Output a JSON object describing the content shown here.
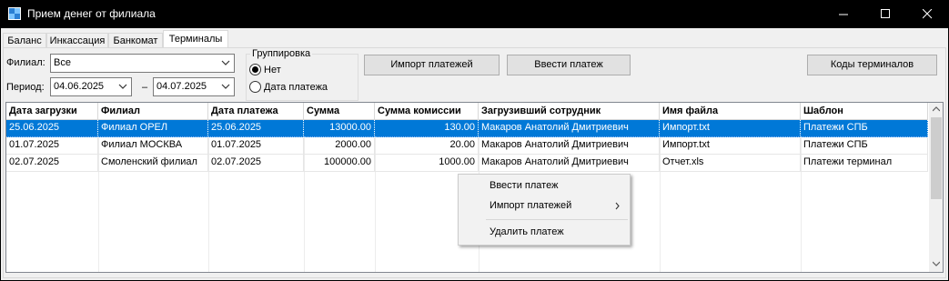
{
  "window": {
    "title": "Прием денег от филиала",
    "icon": "app-grid-icon"
  },
  "tabs": [
    {
      "label": "Баланс",
      "active": false
    },
    {
      "label": "Инкассация",
      "active": false
    },
    {
      "label": "Банкомат",
      "active": false
    },
    {
      "label": "Терминалы",
      "active": true
    }
  ],
  "filters": {
    "branch_label": "Филиал:",
    "branch_value": "Все",
    "period_label": "Период:",
    "date_from": "04.06.2025",
    "date_separator": "–",
    "date_to": "04.07.2025"
  },
  "grouping": {
    "title": "Группировка",
    "options": [
      {
        "label": "Нет",
        "checked": true
      },
      {
        "label": "Дата платежа",
        "checked": false
      }
    ]
  },
  "buttons": {
    "import": "Импорт платежей",
    "enter": "Ввести платеж",
    "terminal_codes": "Коды терминалов"
  },
  "table": {
    "columns": [
      "Дата загрузки",
      "Филиал",
      "Дата платежа",
      "Сумма",
      "Сумма комиссии",
      "Загрузивший сотрудник",
      "Имя файла",
      "Шаблон"
    ],
    "rows": [
      [
        "25.06.2025",
        "Филиал ОРЕЛ",
        "25.06.2025",
        "13000.00",
        "130.00",
        "Макаров Анатолий Дмитриевич",
        "Импорт.txt",
        "Платежи СПБ"
      ],
      [
        "01.07.2025",
        "Филиал МОСКВА",
        "01.07.2025",
        "2000.00",
        "20.00",
        "Макаров Анатолий Дмитриевич",
        "Импорт.txt",
        "Платежи СПБ"
      ],
      [
        "02.07.2025",
        "Смоленский филиал",
        "02.07.2025",
        "100000.00",
        "1000.00",
        "Макаров Анатолий Дмитриевич",
        "Отчет.xls",
        "Платежи терминал"
      ]
    ],
    "selected_row": 0
  },
  "context_menu": {
    "items": [
      "Ввести платеж",
      "Импорт платежей",
      "Удалить платеж"
    ]
  },
  "colors": {
    "selection": "#0078d7",
    "titlebar": "#000000",
    "window_bg": "#f0f0f0"
  }
}
